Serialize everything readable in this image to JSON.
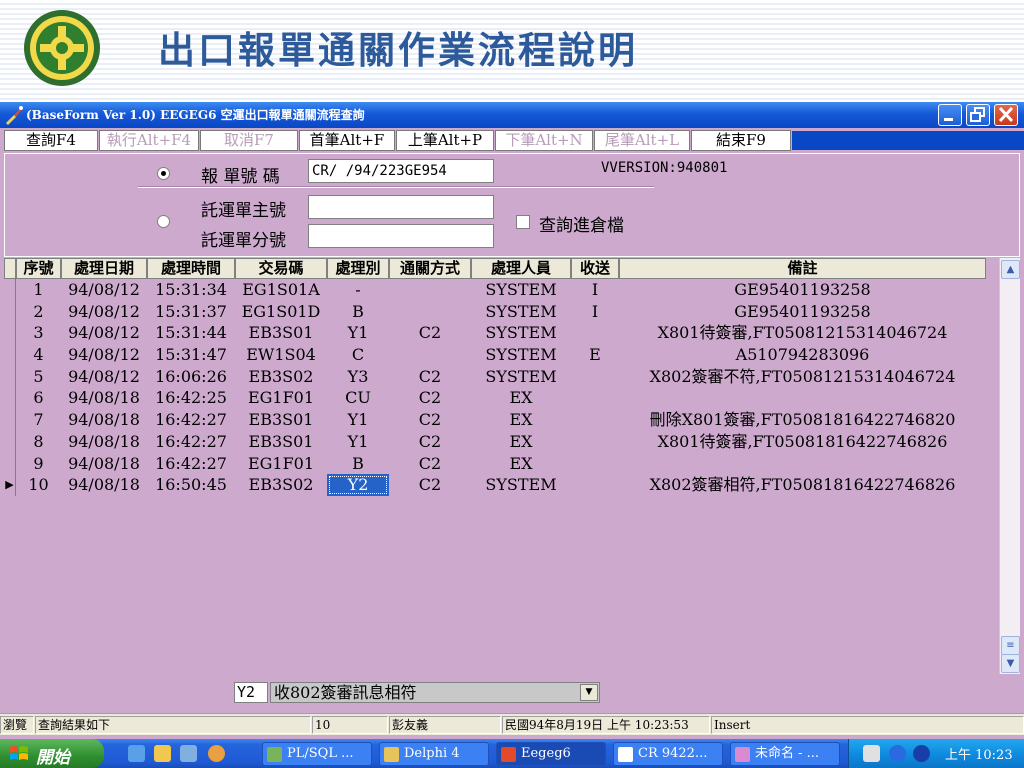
{
  "slide": {
    "title": "出口報單通關作業流程說明"
  },
  "window": {
    "title": "(BaseForm Ver 1.0)  EEGEG6 空運出口報單通關流程查詢",
    "buttons": {
      "minimize": "_",
      "maximize": "□",
      "close": "×"
    }
  },
  "toolbar": {
    "buttons": [
      {
        "label": "查詢F4",
        "enabled": true
      },
      {
        "label": "執行Alt+F4",
        "enabled": false
      },
      {
        "label": "取消F7",
        "enabled": false
      },
      {
        "label": "首筆Alt+F",
        "enabled": true
      },
      {
        "label": "上筆Alt+P",
        "enabled": true
      },
      {
        "label": "下筆Alt+N",
        "enabled": false
      },
      {
        "label": "尾筆Alt+L",
        "enabled": false
      },
      {
        "label": "結束F9",
        "enabled": true
      }
    ]
  },
  "query": {
    "decl_no_label": "報 單號 碼",
    "decl_no_value": "CR/  /94/223GE954",
    "version": "VVERSION:940801",
    "mawb_label": "託運單主號",
    "mawb_value": "",
    "hawb_label": "託運單分號",
    "hawb_value": "",
    "warehouse_checkbox_label": "查詢進倉檔",
    "selected_mode": "decl_no"
  },
  "grid": {
    "columns": [
      "序號",
      "處理日期",
      "處理時間",
      "交易碼",
      "處理別",
      "通關方式",
      "處理人員",
      "收送",
      "備註"
    ],
    "rows": [
      [
        "1",
        "94/08/12",
        "15:31:34",
        "EG1S01A",
        "-",
        "",
        "SYSTEM",
        "I",
        "GE95401193258"
      ],
      [
        "2",
        "94/08/12",
        "15:31:37",
        "EG1S01D",
        "B",
        "",
        "SYSTEM",
        "I",
        "GE95401193258"
      ],
      [
        "3",
        "94/08/12",
        "15:31:44",
        "EB3S01",
        "Y1",
        "C2",
        "SYSTEM",
        "",
        "X801待簽審,FT05081215314046724"
      ],
      [
        "4",
        "94/08/12",
        "15:31:47",
        "EW1S04",
        "C",
        "",
        "SYSTEM",
        "E",
        "A510794283096"
      ],
      [
        "5",
        "94/08/12",
        "16:06:26",
        "EB3S02",
        "Y3",
        "C2",
        "SYSTEM",
        "",
        "X802簽審不符,FT05081215314046724"
      ],
      [
        "6",
        "94/08/18",
        "16:42:25",
        "EG1F01",
        "CU",
        "C2",
        "EX",
        "",
        ""
      ],
      [
        "7",
        "94/08/18",
        "16:42:27",
        "EB3S01",
        "Y1",
        "C2",
        "EX",
        "",
        "刪除X801簽審,FT05081816422746820"
      ],
      [
        "8",
        "94/08/18",
        "16:42:27",
        "EB3S01",
        "Y1",
        "C2",
        "EX",
        "",
        "X801待簽審,FT05081816422746826"
      ],
      [
        "9",
        "94/08/18",
        "16:42:27",
        "EG1F01",
        "B",
        "C2",
        "EX",
        "",
        ""
      ],
      [
        "10",
        "94/08/18",
        "16:50:45",
        "EB3S02",
        "Y2",
        "C2",
        "SYSTEM",
        "",
        "X802簽審相符,FT05081816422746826"
      ]
    ],
    "current_row_marker": "▶"
  },
  "code_lookup": {
    "code": "Y2",
    "description": "收802簽審訊息相符"
  },
  "statusbar": {
    "mode": "瀏覽",
    "message": "查詢結果如下",
    "count": "10",
    "user": "彭友義",
    "datetime": "民國94年8月19日 上午 10:23:53",
    "insert": "Insert"
  },
  "taskbar": {
    "start_label": "開始",
    "tasks": [
      {
        "label": "PL/SQL ...",
        "icon": "plsql-icon"
      },
      {
        "label": "Delphi 4",
        "icon": "delphi-icon"
      },
      {
        "label": "Eegeg6",
        "icon": "app-icon",
        "active": true
      },
      {
        "label": "CR  9422...",
        "icon": "doc-icon"
      },
      {
        "label": "未命名 - ...",
        "icon": "paint-icon"
      }
    ],
    "clock": "上午 10:23"
  },
  "colors": {
    "form_bg": "#cdaacd",
    "title_blue": "#0a47c4",
    "slide_title": "#2d5a9a",
    "selection": "#2563c8"
  }
}
